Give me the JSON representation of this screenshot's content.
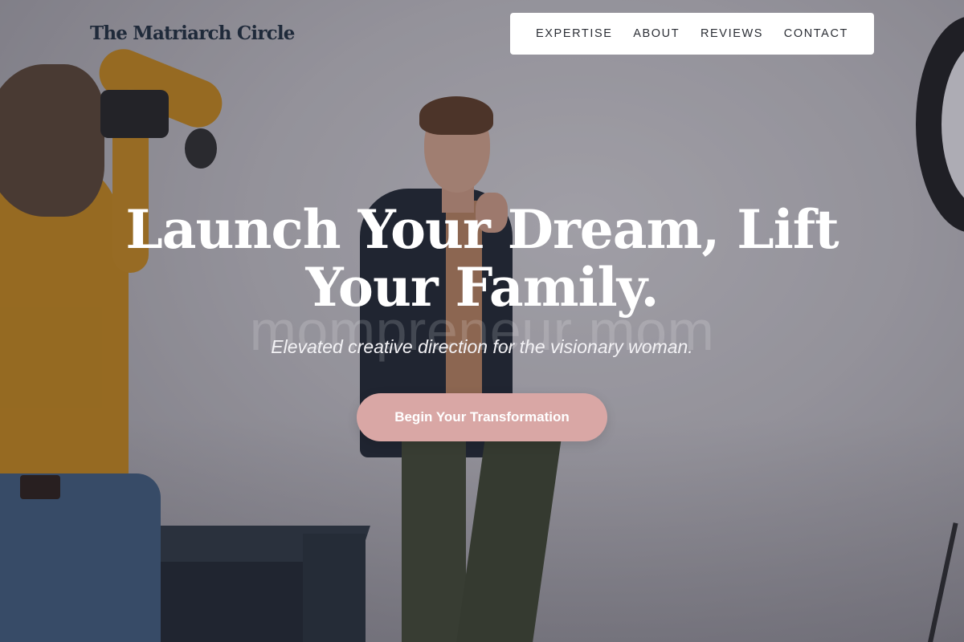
{
  "brand": {
    "name": "The Matriarch Circle"
  },
  "nav": {
    "items": [
      {
        "label": "EXPERTISE"
      },
      {
        "label": "ABOUT"
      },
      {
        "label": "REVIEWS"
      },
      {
        "label": "CONTACT"
      }
    ]
  },
  "hero": {
    "title": "Launch Your Dream, Lift Your Family.",
    "watermark": "mompreneur mom",
    "subtitle": "Elevated creative direction for the visionary woman.",
    "cta_label": "Begin Your Transformation",
    "background_image": "photo-studio-photographer-and-model"
  },
  "colors": {
    "brand_text": "#1f2a3a",
    "cta_background": "#d9a7a5",
    "nav_background": "#ffffff",
    "hero_text": "#ffffff"
  }
}
